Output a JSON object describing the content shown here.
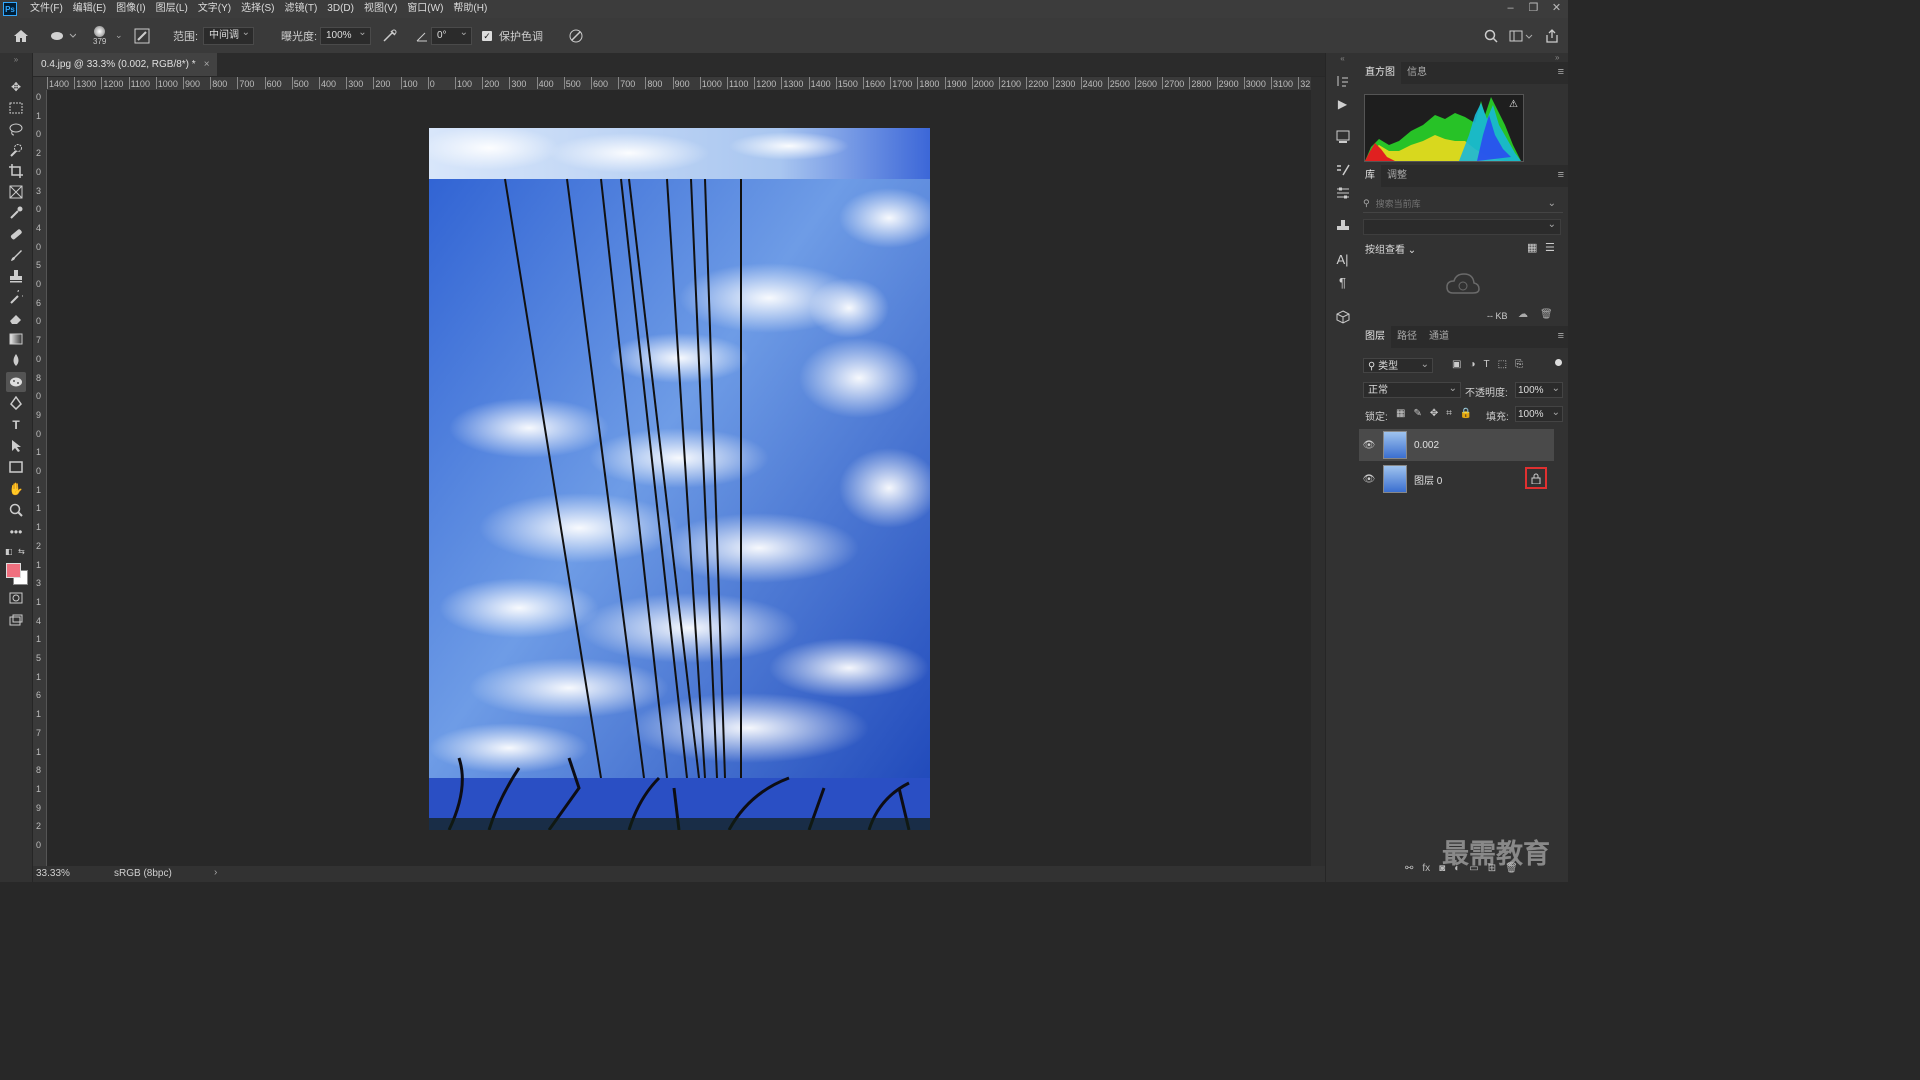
{
  "menubar": {
    "app_logo": "Ps",
    "items": [
      "文件(F)",
      "编辑(E)",
      "图像(I)",
      "图层(L)",
      "文字(Y)",
      "选择(S)",
      "滤镜(T)",
      "3D(D)",
      "视图(V)",
      "窗口(W)",
      "帮助(H)"
    ]
  },
  "options": {
    "brush_size": "379",
    "range_label": "范围:",
    "range_value": "中间调",
    "exposure_label": "曝光度:",
    "exposure_value": "100%",
    "angle_value": "0°",
    "protect_tones_label": "保护色调"
  },
  "document": {
    "tab_title": "0.4.jpg @ 33.3% (0.002, RGB/8*) *",
    "zoom": "33.33%",
    "color_profile": "sRGB (8bpc)"
  },
  "ruler_h": [
    "1400",
    "1300",
    "1200",
    "1100",
    "1000",
    "900",
    "800",
    "700",
    "600",
    "500",
    "400",
    "300",
    "200",
    "100",
    "0",
    "100",
    "200",
    "300",
    "400",
    "500",
    "600",
    "700",
    "800",
    "900",
    "1000",
    "1100",
    "1200",
    "1300",
    "1400",
    "1500",
    "1600",
    "1700",
    "1800",
    "1900",
    "2000",
    "2100",
    "2200",
    "2300",
    "2400",
    "2500",
    "2600",
    "2700",
    "2800",
    "2900",
    "3000",
    "3100",
    "32"
  ],
  "ruler_v": [
    "0",
    "1",
    "0",
    "2",
    "0",
    "3",
    "0",
    "4",
    "0",
    "5",
    "0",
    "6",
    "0",
    "7",
    "0",
    "8",
    "0",
    "9",
    "0",
    "1",
    "0",
    "1",
    "1",
    "1",
    "2",
    "1",
    "3",
    "1",
    "4",
    "1",
    "5",
    "1",
    "6",
    "1",
    "7",
    "1",
    "8",
    "1",
    "9",
    "2",
    "0"
  ],
  "panels": {
    "histogram_tabs": [
      "直方图",
      "信息"
    ],
    "library_tabs": [
      "库",
      "调整"
    ],
    "library_search_placeholder": "搜索当前库",
    "group_view_label": "按组查看",
    "library_size": "-- KB",
    "layers_tabs": [
      "图层",
      "路径",
      "通道"
    ],
    "filter_kind": "类型",
    "blend_mode": "正常",
    "opacity_label": "不透明度:",
    "opacity_value": "100%",
    "lock_label": "锁定:",
    "fill_label": "填充:",
    "fill_value": "100%",
    "layers": [
      {
        "name": "0.002"
      },
      {
        "name": "图层 0"
      }
    ]
  },
  "watermark": "最需教育",
  "colors": {
    "foreground": "#f0707f",
    "background": "#ffffff",
    "highlight_box": "#e03030"
  }
}
